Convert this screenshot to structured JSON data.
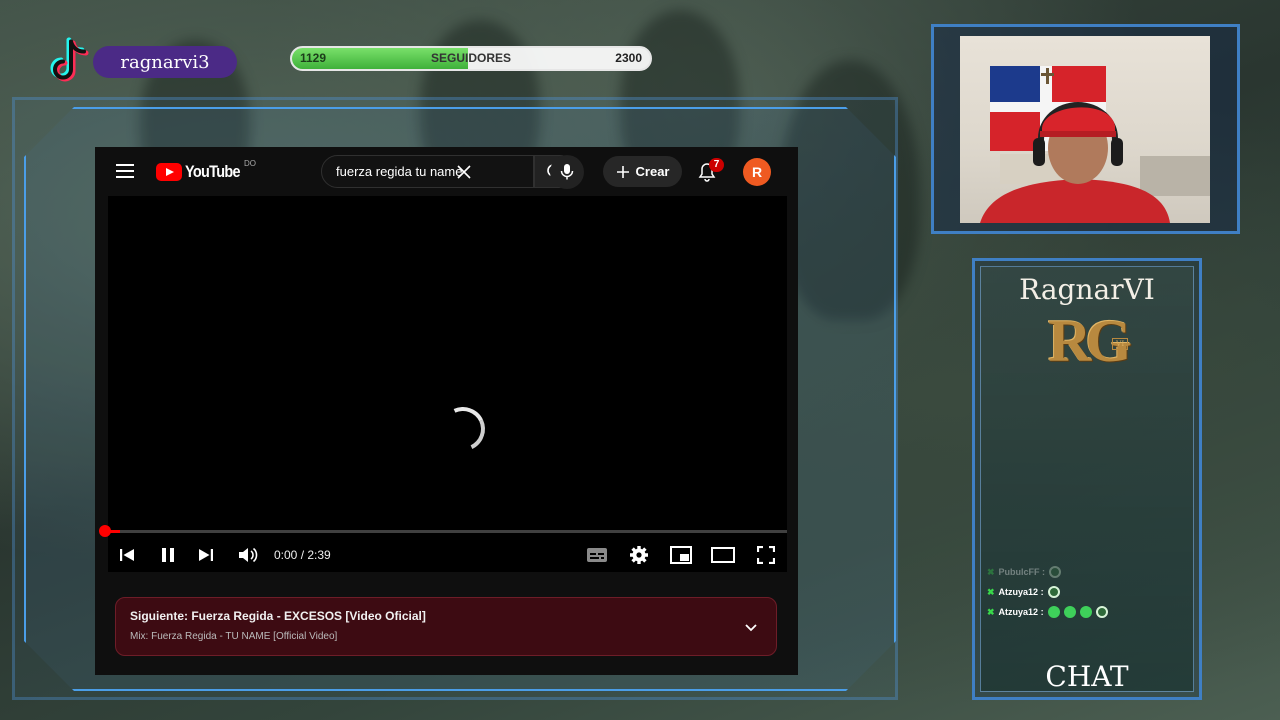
{
  "overlay": {
    "tiktok_username": "ragnarvi3",
    "followers": {
      "current": "1129",
      "label": "SEGUIDORES",
      "target": "2300",
      "progress_fraction": 0.4909
    }
  },
  "youtube": {
    "logo_text": "YouTube",
    "country_code": "DO",
    "search_value": "fuerza regida tu name",
    "create_label": "Crear",
    "notifications_count": "7",
    "avatar_letter": "R",
    "player": {
      "time": "0:00 / 2:39",
      "progress_fraction": 0.0
    },
    "up_next": {
      "title": "Siguiente: Fuerza Regida - EXCESOS [Video Oficial]",
      "subtitle": "Mix: Fuerza Regida - TU NAME [Official Video]"
    },
    "colors": {
      "brand_red": "#ff0000",
      "avatar": "#ef5a21",
      "up_next_bg": "#3d0b12"
    }
  },
  "chat_panel": {
    "brand": "RagnarVI",
    "emblem": "RG",
    "emblem_badge": "VI",
    "messages": [
      {
        "user": "PubulcFF :",
        "faded": true,
        "emotes": 1
      },
      {
        "user": "Atzuya12 :",
        "faded": false,
        "emotes": 1
      },
      {
        "user": "Atzuya12 :",
        "faded": false,
        "emotes": 4
      }
    ],
    "label": "CHAT"
  }
}
